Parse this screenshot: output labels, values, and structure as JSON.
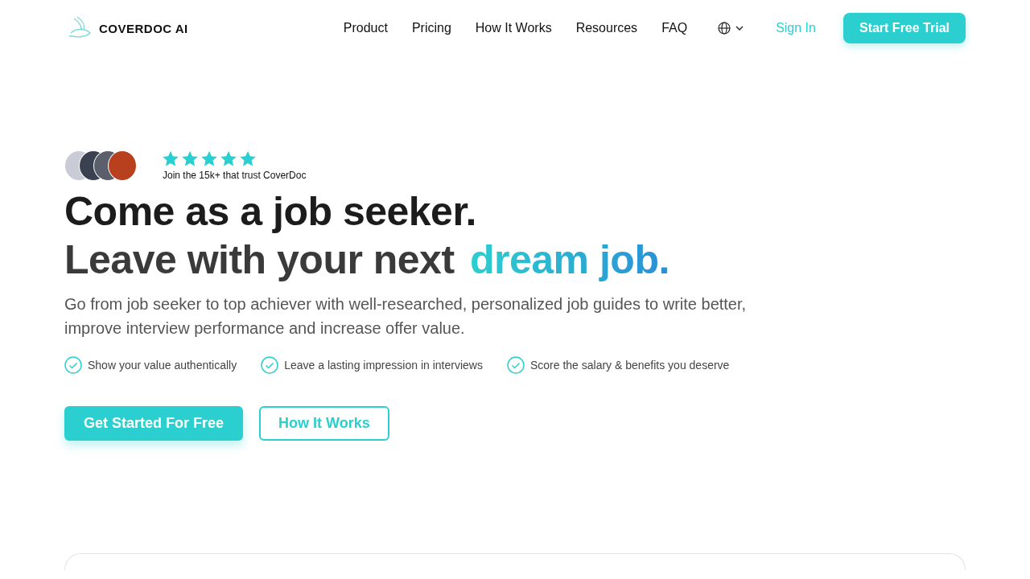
{
  "nav": {
    "logo": "COVERDOC AI",
    "links": [
      "Product",
      "Pricing",
      "How It Works",
      "Resources",
      "FAQ"
    ],
    "sign_in": "Sign In",
    "cta": "Start Free Trial"
  },
  "hero": {
    "stars": 5,
    "trust_text": "Join the 15k+ that trust CoverDoc",
    "headline_line1": "Come as a job seeker.",
    "headline_line2": "Leave with your next",
    "headline_highlight": "dream job.",
    "subtitle": "Go from job seeker to top achiever with well-researched, personalized job guides to write better, improve interview performance and increase offer value.",
    "benefits": [
      "Show your value authentically",
      "Leave a lasting impression in interviews",
      "Score the salary & benefits you deserve"
    ],
    "primary_button": "Get Started For Free",
    "secondary_button": "How It Works"
  }
}
